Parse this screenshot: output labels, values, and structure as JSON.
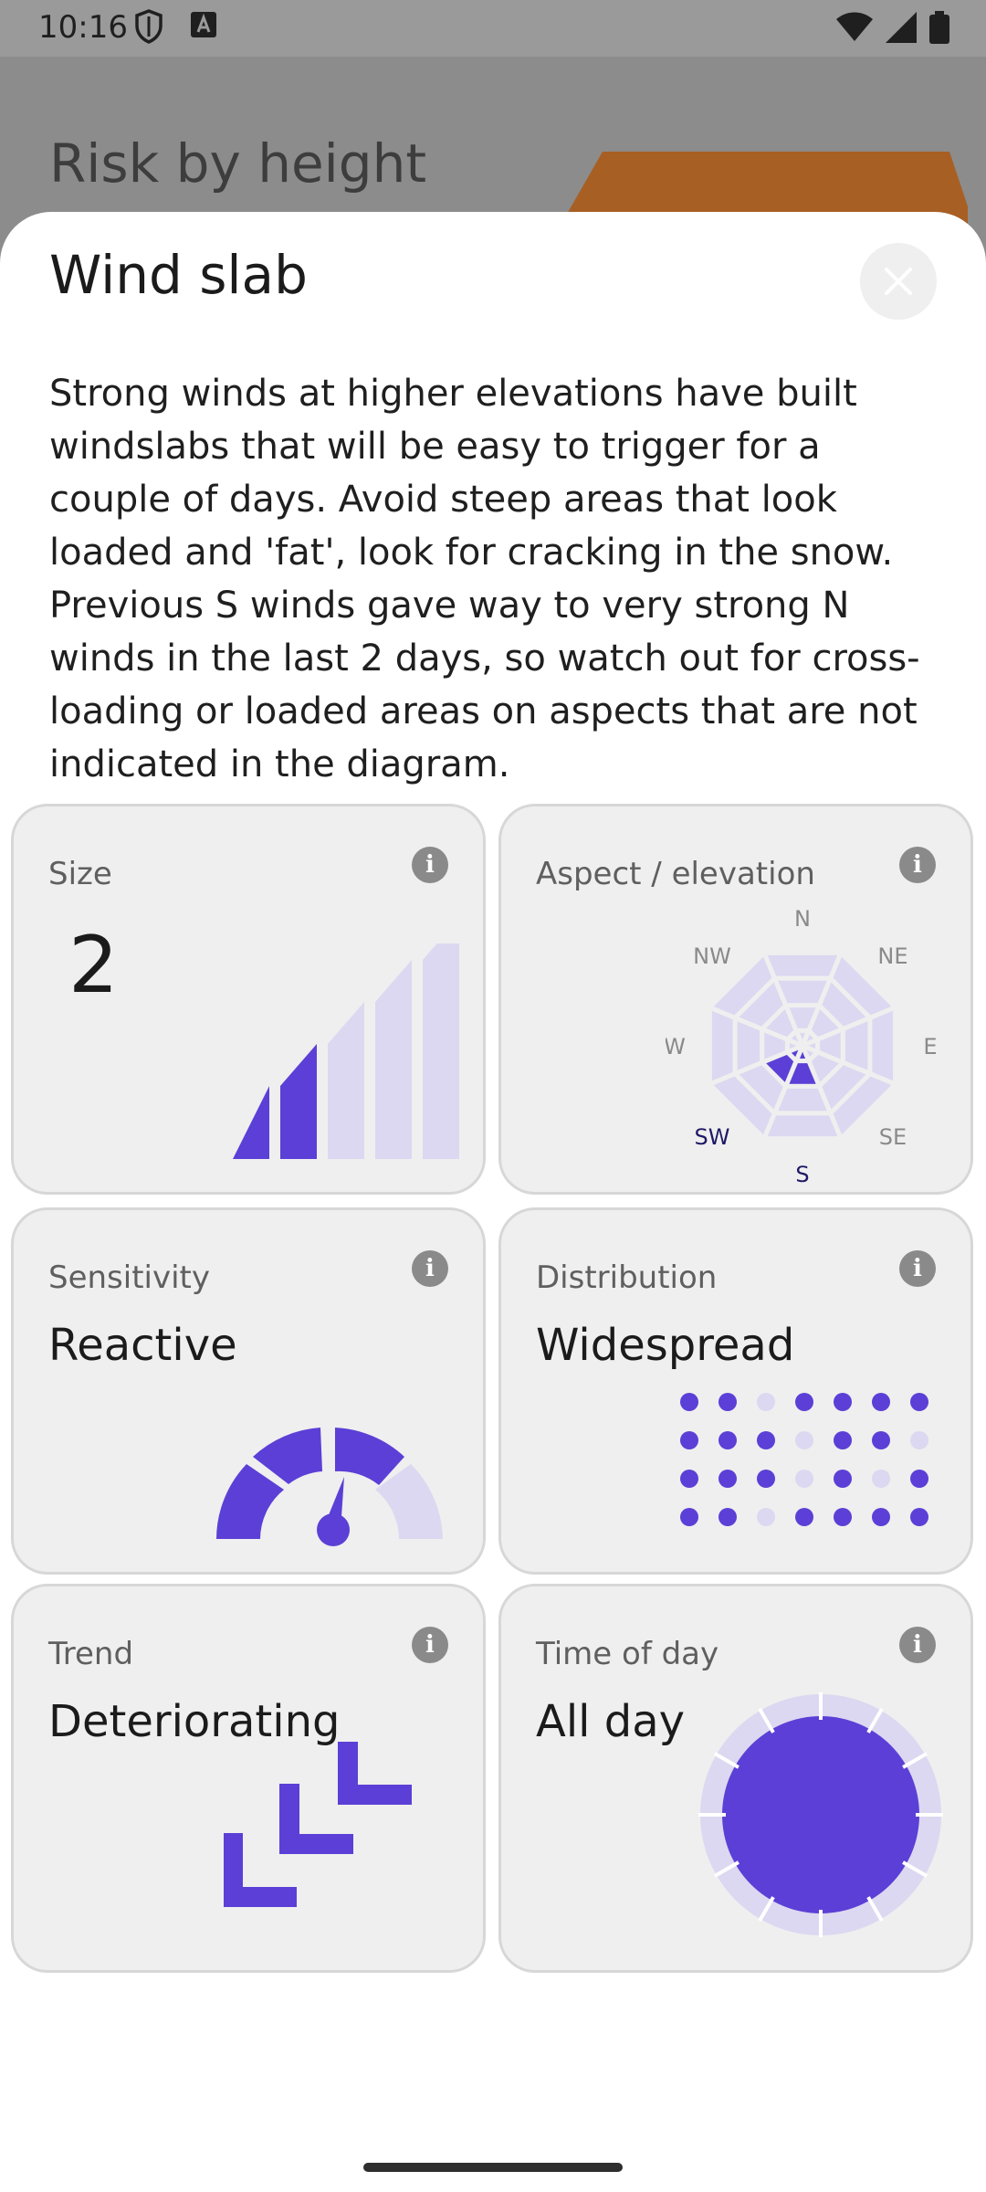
{
  "status_bar": {
    "time": "10:16"
  },
  "background": {
    "title": "Risk by height"
  },
  "sheet": {
    "title": "Wind slab",
    "description": "Strong winds at higher elevations have built windslabs that will be easy to trigger for a couple of days. Avoid steep areas that look loaded and 'fat', look for cracking in the snow. Previous S winds gave way to very strong N winds in the last 2 days, so watch out for cross-loading or loaded areas on aspects that are not indicated in the diagram."
  },
  "cards": {
    "size": {
      "label": "Size",
      "value": "2",
      "level": 2,
      "max": 5
    },
    "aspect": {
      "label": "Aspect / elevation",
      "directions": [
        "N",
        "NE",
        "E",
        "SE",
        "S",
        "SW",
        "W",
        "NW"
      ],
      "highlighted": [
        "S",
        "SW"
      ]
    },
    "sensitivity": {
      "label": "Sensitivity",
      "value": "Reactive"
    },
    "distribution": {
      "label": "Distribution",
      "value": "Widespread"
    },
    "trend": {
      "label": "Trend",
      "value": "Deteriorating"
    },
    "time_of_day": {
      "label": "Time of day",
      "value": "All day"
    }
  },
  "info_glyph": "i",
  "colors": {
    "accent": "#5c3fd6",
    "accent_light": "#dcd8f1",
    "card_bg": "#efefef"
  }
}
